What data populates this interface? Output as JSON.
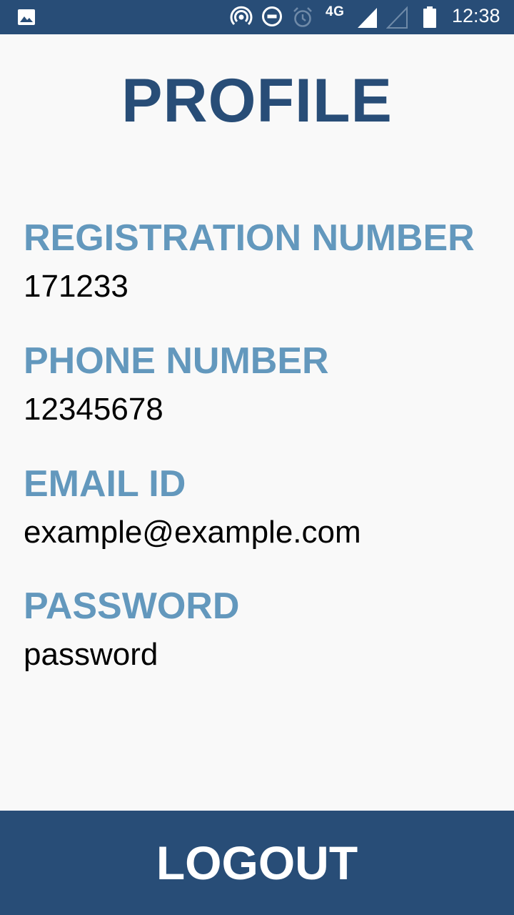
{
  "status_bar": {
    "network": "4G",
    "time": "12:38",
    "icons": [
      "image-icon",
      "hotspot-icon",
      "do-not-disturb-icon",
      "alarm-icon",
      "signal-icon",
      "signal-weak-icon",
      "battery-icon"
    ]
  },
  "profile": {
    "title": "PROFILE",
    "fields": [
      {
        "label": "REGISTRATION NUMBER",
        "value": "171233"
      },
      {
        "label": "PHONE NUMBER",
        "value": "12345678"
      },
      {
        "label": "EMAIL ID",
        "value": "example@example.com"
      },
      {
        "label": "PASSWORD",
        "value": "password"
      }
    ]
  },
  "logout": {
    "label": "LOGOUT"
  },
  "colors": {
    "primary": "#284d77",
    "label": "#6398bd",
    "background": "#f9f9f9",
    "text": "#000000"
  }
}
